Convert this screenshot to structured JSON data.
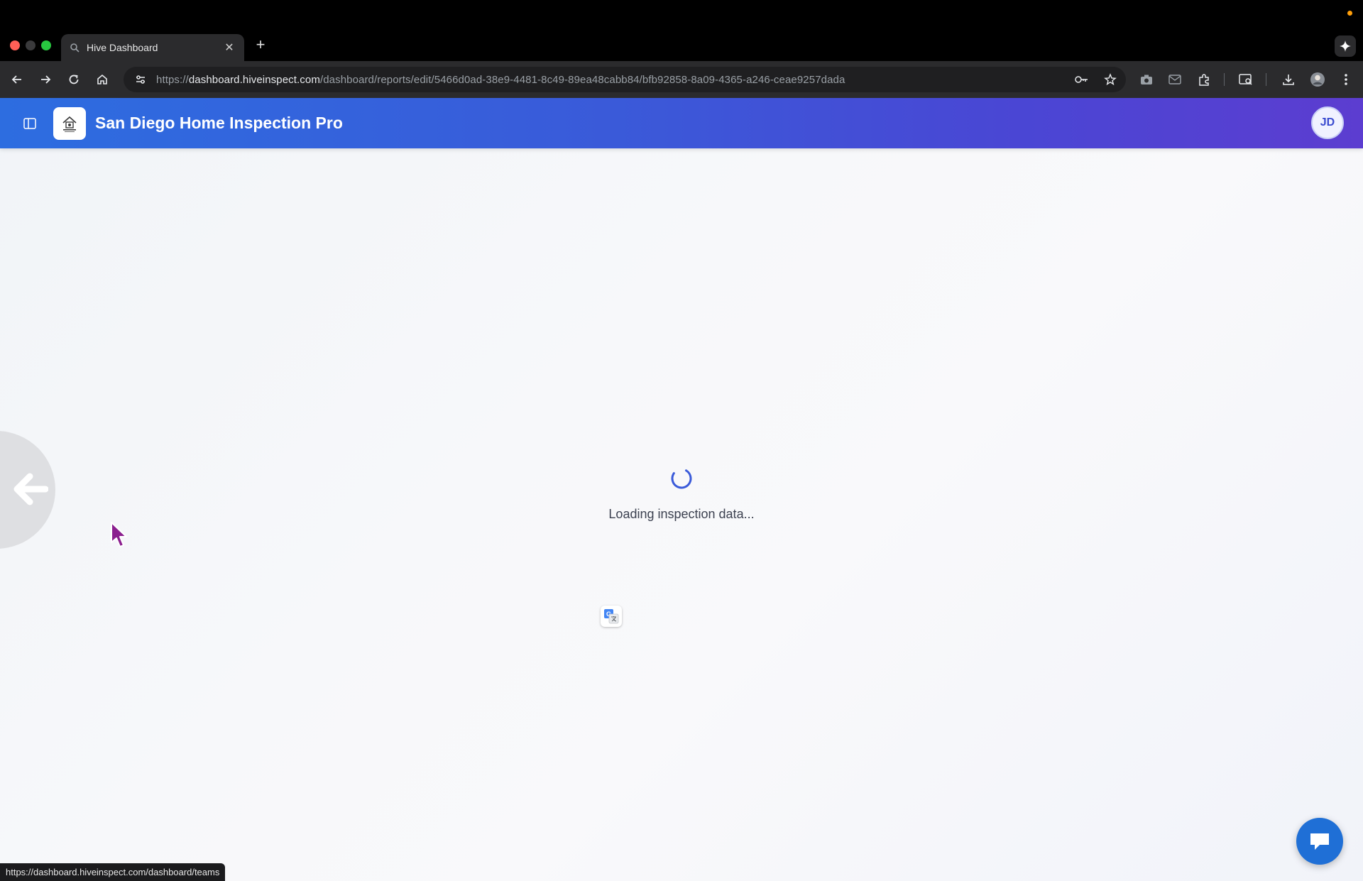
{
  "browser": {
    "tab": {
      "title": "Hive Dashboard"
    },
    "url": {
      "scheme": "https://",
      "host": "dashboard.hiveinspect.com",
      "path": "/dashboard/reports/edit/5466d0ad-38e9-4481-8c49-89ea48cabb84/bfb92858-8a09-4365-a246-ceae9257dada"
    },
    "status_url": "https://dashboard.hiveinspect.com/dashboard/teams"
  },
  "header": {
    "title": "San Diego Home Inspection Pro",
    "avatar_initials": "JD"
  },
  "main": {
    "loading_text": "Loading inspection data..."
  },
  "colors": {
    "header_start": "#2d6de0",
    "header_end": "#5c3dd0",
    "spinner": "#3a5ad9",
    "chat_button": "#1f6fd6"
  }
}
